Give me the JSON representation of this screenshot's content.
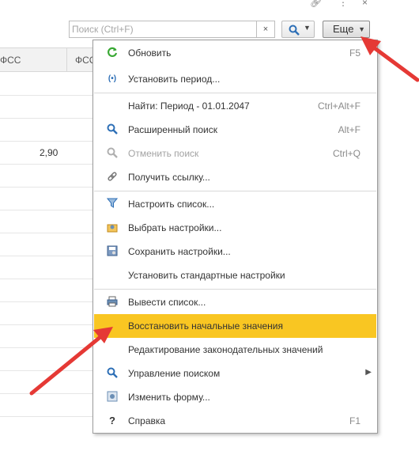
{
  "toolbar": {
    "search_placeholder": "Поиск (Ctrl+F)",
    "clear_symbol": "×",
    "more_label": "Еще",
    "top_icons": [
      "link-icon",
      "more-vertical-icon",
      "close-icon"
    ]
  },
  "table": {
    "headers": [
      "ФСС",
      "ФСС"
    ],
    "cell_value": "2,90"
  },
  "menu": {
    "items": [
      {
        "label": "Обновить",
        "shortcut": "F5",
        "icon": "refresh-icon"
      },
      {
        "label": "Установить период...",
        "shortcut": "",
        "icon": "period-icon"
      },
      {
        "label": "Найти: Период - 01.01.2047",
        "shortcut": "Ctrl+Alt+F",
        "icon": ""
      },
      {
        "label": "Расширенный поиск",
        "shortcut": "Alt+F",
        "icon": "search-icon"
      },
      {
        "label": "Отменить поиск",
        "shortcut": "Ctrl+Q",
        "icon": "cancel-search-icon",
        "disabled": true
      },
      {
        "label": "Получить ссылку...",
        "shortcut": "",
        "icon": "link-icon"
      },
      {
        "label": "Настроить список...",
        "shortcut": "",
        "icon": "settings-list-icon"
      },
      {
        "label": "Выбрать настройки...",
        "shortcut": "",
        "icon": "open-settings-icon"
      },
      {
        "label": "Сохранить настройки...",
        "shortcut": "",
        "icon": "save-settings-icon"
      },
      {
        "label": "Установить стандартные настройки",
        "shortcut": "",
        "icon": ""
      },
      {
        "label": "Вывести список...",
        "shortcut": "",
        "icon": "print-list-icon"
      },
      {
        "label": "Восстановить начальные значения",
        "shortcut": "",
        "icon": "",
        "highlighted": true
      },
      {
        "label": "Редактирование законодательных значений",
        "shortcut": "",
        "icon": ""
      },
      {
        "label": "Управление поиском",
        "shortcut": "",
        "icon": "search-icon",
        "submenu": true
      },
      {
        "label": "Изменить форму...",
        "shortcut": "",
        "icon": "change-form-icon"
      },
      {
        "label": "Справка",
        "shortcut": "F1",
        "icon": "help-icon"
      }
    ]
  },
  "colors": {
    "highlight": "#f9c622",
    "arrow": "#e53935",
    "refresh_green": "#3aa935",
    "search_blue": "#2d6fb6"
  }
}
